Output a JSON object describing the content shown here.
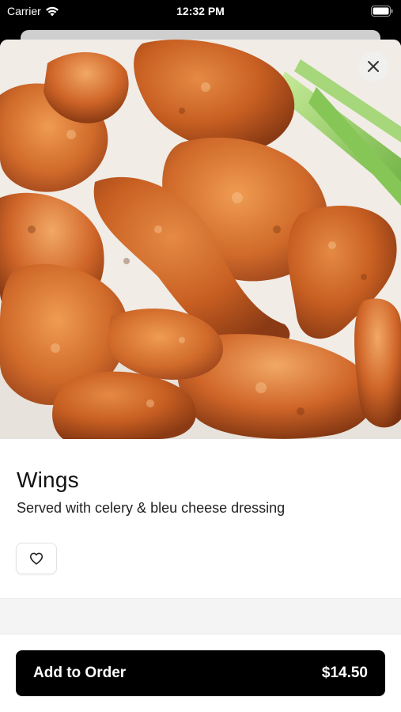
{
  "status_bar": {
    "carrier": "Carrier",
    "time": "12:32 PM"
  },
  "item": {
    "name": "Wings",
    "description": "Served with celery & bleu cheese dressing",
    "image_icon": "food-photo",
    "price": "$14.50"
  },
  "actions": {
    "add_to_order_label": "Add to Order",
    "close_icon": "close-icon",
    "favorite_icon": "heart-outline-icon"
  },
  "colors": {
    "primary_button": "#000000",
    "wing_sauce": "#c2581e",
    "celery": "#8fcf5a"
  }
}
